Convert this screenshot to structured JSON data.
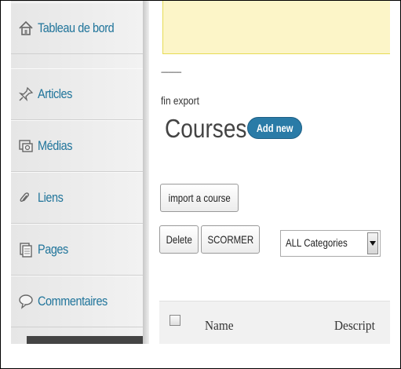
{
  "sidebar": {
    "items": [
      {
        "label": "Tableau de bord",
        "icon": "home-icon"
      },
      {
        "label": "Articles",
        "icon": "pin-icon"
      },
      {
        "label": "Médias",
        "icon": "media-icon"
      },
      {
        "label": "Liens",
        "icon": "link-icon"
      },
      {
        "label": "Pages",
        "icon": "pages-icon"
      },
      {
        "label": "Commentaires",
        "icon": "comment-icon"
      }
    ],
    "link_color": "#21759b"
  },
  "main": {
    "dots": "-----------",
    "status_text": "fin export",
    "page_title": "Courses",
    "add_new_label": "Add new",
    "import_label": "import a course",
    "delete_label": "Delete",
    "scormer_label": "SCORMER",
    "category_select": {
      "selected": "ALL Categories"
    },
    "table": {
      "columns": [
        "Name",
        "Descript"
      ]
    }
  },
  "colors": {
    "accent": "#2a7ba7",
    "notice_bg": "#fcf5c8"
  }
}
